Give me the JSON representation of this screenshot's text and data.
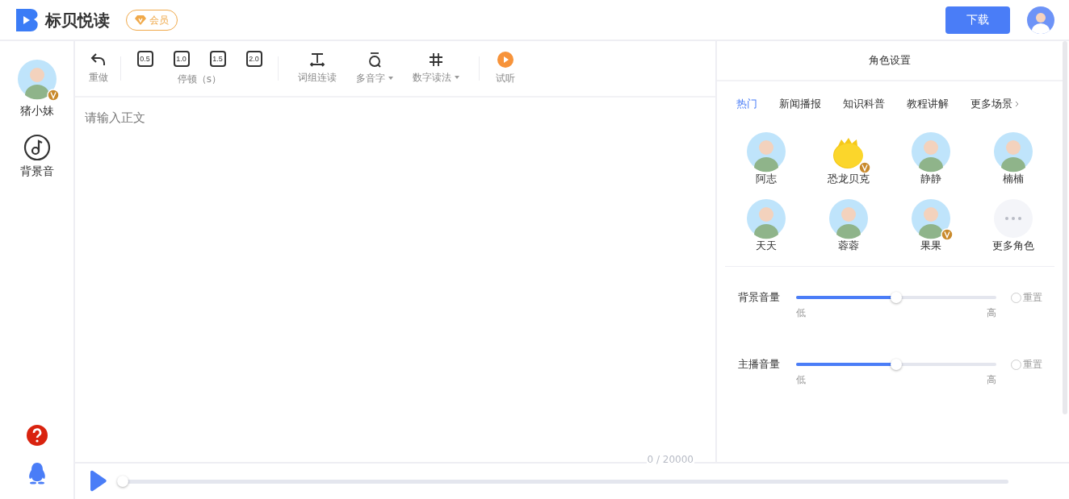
{
  "header": {
    "logo_text": "标贝悦读",
    "member_badge": "会员",
    "download_button": "下载"
  },
  "sidebar": {
    "items": [
      {
        "kind": "avatar",
        "label": "猪小妹",
        "vip": true
      },
      {
        "kind": "music",
        "label": "背景音"
      }
    ]
  },
  "toolbar": {
    "undo": "重做",
    "pause_values": [
      "0.5",
      "1.0",
      "1.5",
      "2.0"
    ],
    "pause_label": "停顿（s）",
    "tools": [
      {
        "kind": "phrase",
        "label": "词组连读",
        "dropdown": false
      },
      {
        "kind": "polyphone",
        "label": "多音字",
        "dropdown": true
      },
      {
        "kind": "number",
        "label": "数字读法",
        "dropdown": true
      }
    ],
    "preview": "试听"
  },
  "editor": {
    "placeholder": "请输入正文",
    "counter": "0 / 20000"
  },
  "player": {
    "level": 0
  },
  "role_panel": {
    "title": "角色设置",
    "tabs": [
      {
        "label": "热门",
        "selected": true
      },
      {
        "label": "新闻播报",
        "selected": false
      },
      {
        "label": "知识科普",
        "selected": false
      },
      {
        "label": "教程讲解",
        "selected": false
      }
    ],
    "more_scenes": "更多场景",
    "voices": [
      {
        "kind": "person",
        "name": "阿志",
        "vip": false
      },
      {
        "kind": "creature",
        "name": "恐龙贝克",
        "vip": true
      },
      {
        "kind": "person",
        "name": "静静",
        "vip": false
      },
      {
        "kind": "person",
        "name": "楠楠",
        "vip": false
      },
      {
        "kind": "person",
        "name": "天天",
        "vip": false
      },
      {
        "kind": "person",
        "name": "蓉蓉",
        "vip": false
      },
      {
        "kind": "person",
        "name": "果果",
        "vip": true
      },
      {
        "kind": "more",
        "name": "更多角色",
        "vip": false
      }
    ],
    "volumes": [
      {
        "label": "背景音量",
        "level": 0.5,
        "low": "低",
        "high": "高",
        "reset": "重置"
      },
      {
        "label": "主播音量",
        "level": 0.5,
        "low": "低",
        "high": "高",
        "reset": "重置"
      }
    ]
  }
}
